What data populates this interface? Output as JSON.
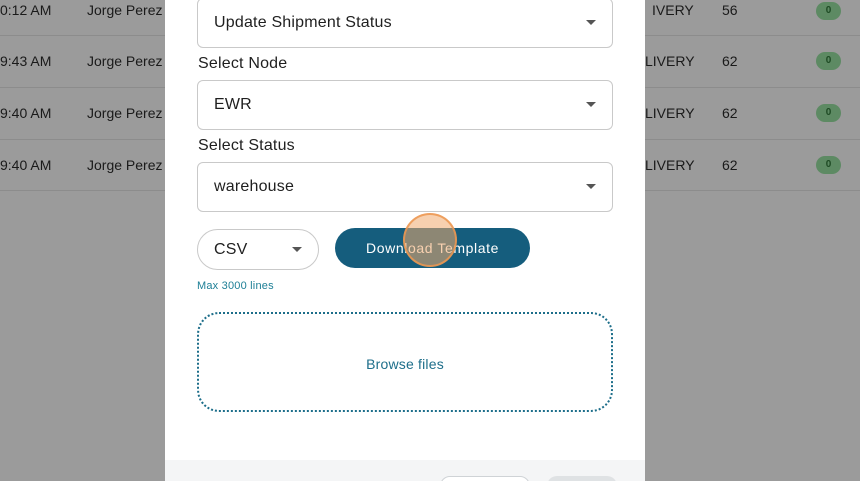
{
  "background_table": {
    "rows": [
      {
        "time": "0:12 AM",
        "user": "Jorge Perez",
        "status": "IVERY",
        "count": "56",
        "badge": "0"
      },
      {
        "time": "9:43 AM",
        "user": "Jorge Perez",
        "status": "LIVERY",
        "count": "62",
        "badge": "0"
      },
      {
        "time": "9:40 AM",
        "user": "Jorge Perez",
        "status": "LIVERY",
        "count": "62",
        "badge": "0"
      },
      {
        "time": "9:40 AM",
        "user": "Jorge Perez",
        "status": "LIVERY",
        "count": "62",
        "badge": "0"
      }
    ]
  },
  "modal": {
    "action_select": {
      "value": "Update Shipment Status"
    },
    "node_select": {
      "label": "Select Node",
      "value": "EWR"
    },
    "status_select": {
      "label": "Select Status",
      "value": "warehouse"
    },
    "format_select": {
      "value": "CSV"
    },
    "download_button": {
      "label": "Download Template"
    },
    "max_lines_hint": "Max 3000 lines",
    "dropzone": {
      "browse_label": "Browse files"
    }
  },
  "colors": {
    "primary": "#155d7d",
    "link": "#1d6e8a",
    "badge_bg": "#5d8a63",
    "overlay_bg": "#9b9b9b"
  }
}
